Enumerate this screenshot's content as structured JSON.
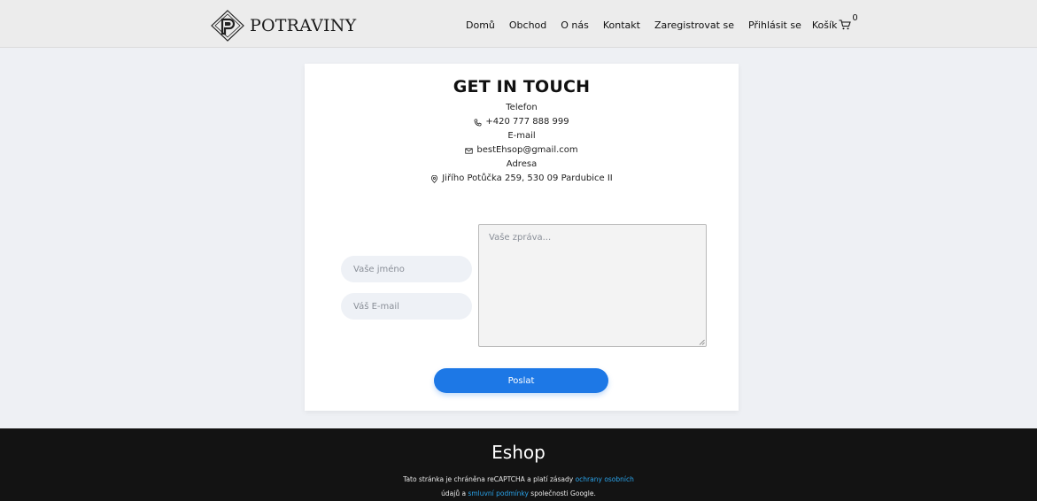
{
  "header": {
    "brand": "POTRAVINY",
    "nav": [
      {
        "label": "Domů"
      },
      {
        "label": "Obchod"
      },
      {
        "label": "O nás"
      },
      {
        "label": "Kontakt"
      },
      {
        "label": "Zaregistrovat se"
      },
      {
        "label": "Přihlásit se"
      }
    ],
    "cart": {
      "label": "Košík",
      "count": "0",
      "icon": "cart-icon"
    }
  },
  "contact": {
    "title": "GET IN TOUCH",
    "phone_label": "Telefon",
    "phone": "+420 777 888 999",
    "phone_icon": "phone-icon",
    "email_label": "E-mail",
    "email": "bestEhsop@gmail.com",
    "email_icon": "mail-icon",
    "address_label": "Adresa",
    "address": "Jiřího Potůčka 259, 530 09 Pardubice II",
    "address_icon": "location-pin-icon"
  },
  "form": {
    "name_placeholder": "Vaše jméno",
    "email_placeholder": "Váš E-mail",
    "message_placeholder": "Vaše zpráva...",
    "submit_label": "Poslat"
  },
  "footer": {
    "title": "Eshop",
    "text_part1": "Tato stránka je chráněna reCAPTCHA a platí zásady ",
    "link1": "ochrany osobních",
    "text_part2": "údajů a ",
    "link2": "smluvní podmínky",
    "text_part3": " společnosti Google."
  },
  "colors": {
    "accent": "#1d78e6",
    "link": "#2aa3ea",
    "footer_bg": "#131313",
    "header_bg": "#ececec"
  }
}
